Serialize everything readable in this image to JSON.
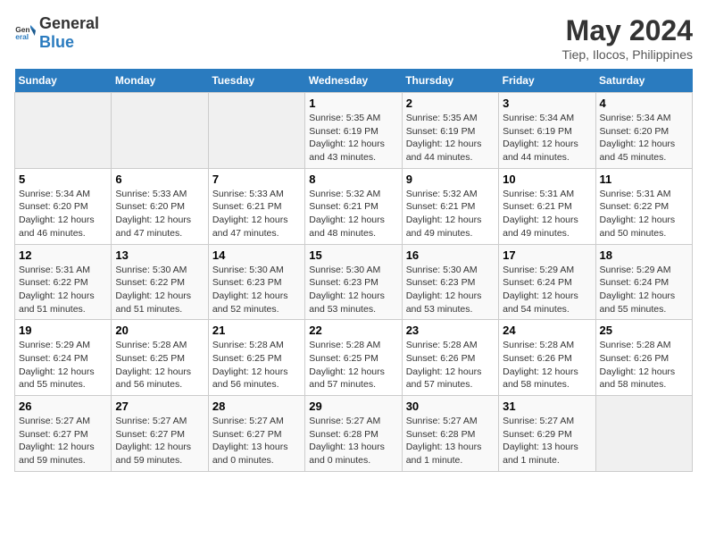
{
  "header": {
    "logo_general": "General",
    "logo_blue": "Blue",
    "title": "May 2024",
    "subtitle": "Tiep, Ilocos, Philippines"
  },
  "weekdays": [
    "Sunday",
    "Monday",
    "Tuesday",
    "Wednesday",
    "Thursday",
    "Friday",
    "Saturday"
  ],
  "weeks": [
    [
      {
        "day": "",
        "info": ""
      },
      {
        "day": "",
        "info": ""
      },
      {
        "day": "",
        "info": ""
      },
      {
        "day": "1",
        "info": "Sunrise: 5:35 AM\nSunset: 6:19 PM\nDaylight: 12 hours\nand 43 minutes."
      },
      {
        "day": "2",
        "info": "Sunrise: 5:35 AM\nSunset: 6:19 PM\nDaylight: 12 hours\nand 44 minutes."
      },
      {
        "day": "3",
        "info": "Sunrise: 5:34 AM\nSunset: 6:19 PM\nDaylight: 12 hours\nand 44 minutes."
      },
      {
        "day": "4",
        "info": "Sunrise: 5:34 AM\nSunset: 6:20 PM\nDaylight: 12 hours\nand 45 minutes."
      }
    ],
    [
      {
        "day": "5",
        "info": "Sunrise: 5:34 AM\nSunset: 6:20 PM\nDaylight: 12 hours\nand 46 minutes."
      },
      {
        "day": "6",
        "info": "Sunrise: 5:33 AM\nSunset: 6:20 PM\nDaylight: 12 hours\nand 47 minutes."
      },
      {
        "day": "7",
        "info": "Sunrise: 5:33 AM\nSunset: 6:21 PM\nDaylight: 12 hours\nand 47 minutes."
      },
      {
        "day": "8",
        "info": "Sunrise: 5:32 AM\nSunset: 6:21 PM\nDaylight: 12 hours\nand 48 minutes."
      },
      {
        "day": "9",
        "info": "Sunrise: 5:32 AM\nSunset: 6:21 PM\nDaylight: 12 hours\nand 49 minutes."
      },
      {
        "day": "10",
        "info": "Sunrise: 5:31 AM\nSunset: 6:21 PM\nDaylight: 12 hours\nand 49 minutes."
      },
      {
        "day": "11",
        "info": "Sunrise: 5:31 AM\nSunset: 6:22 PM\nDaylight: 12 hours\nand 50 minutes."
      }
    ],
    [
      {
        "day": "12",
        "info": "Sunrise: 5:31 AM\nSunset: 6:22 PM\nDaylight: 12 hours\nand 51 minutes."
      },
      {
        "day": "13",
        "info": "Sunrise: 5:30 AM\nSunset: 6:22 PM\nDaylight: 12 hours\nand 51 minutes."
      },
      {
        "day": "14",
        "info": "Sunrise: 5:30 AM\nSunset: 6:23 PM\nDaylight: 12 hours\nand 52 minutes."
      },
      {
        "day": "15",
        "info": "Sunrise: 5:30 AM\nSunset: 6:23 PM\nDaylight: 12 hours\nand 53 minutes."
      },
      {
        "day": "16",
        "info": "Sunrise: 5:30 AM\nSunset: 6:23 PM\nDaylight: 12 hours\nand 53 minutes."
      },
      {
        "day": "17",
        "info": "Sunrise: 5:29 AM\nSunset: 6:24 PM\nDaylight: 12 hours\nand 54 minutes."
      },
      {
        "day": "18",
        "info": "Sunrise: 5:29 AM\nSunset: 6:24 PM\nDaylight: 12 hours\nand 55 minutes."
      }
    ],
    [
      {
        "day": "19",
        "info": "Sunrise: 5:29 AM\nSunset: 6:24 PM\nDaylight: 12 hours\nand 55 minutes."
      },
      {
        "day": "20",
        "info": "Sunrise: 5:28 AM\nSunset: 6:25 PM\nDaylight: 12 hours\nand 56 minutes."
      },
      {
        "day": "21",
        "info": "Sunrise: 5:28 AM\nSunset: 6:25 PM\nDaylight: 12 hours\nand 56 minutes."
      },
      {
        "day": "22",
        "info": "Sunrise: 5:28 AM\nSunset: 6:25 PM\nDaylight: 12 hours\nand 57 minutes."
      },
      {
        "day": "23",
        "info": "Sunrise: 5:28 AM\nSunset: 6:26 PM\nDaylight: 12 hours\nand 57 minutes."
      },
      {
        "day": "24",
        "info": "Sunrise: 5:28 AM\nSunset: 6:26 PM\nDaylight: 12 hours\nand 58 minutes."
      },
      {
        "day": "25",
        "info": "Sunrise: 5:28 AM\nSunset: 6:26 PM\nDaylight: 12 hours\nand 58 minutes."
      }
    ],
    [
      {
        "day": "26",
        "info": "Sunrise: 5:27 AM\nSunset: 6:27 PM\nDaylight: 12 hours\nand 59 minutes."
      },
      {
        "day": "27",
        "info": "Sunrise: 5:27 AM\nSunset: 6:27 PM\nDaylight: 12 hours\nand 59 minutes."
      },
      {
        "day": "28",
        "info": "Sunrise: 5:27 AM\nSunset: 6:27 PM\nDaylight: 13 hours\nand 0 minutes."
      },
      {
        "day": "29",
        "info": "Sunrise: 5:27 AM\nSunset: 6:28 PM\nDaylight: 13 hours\nand 0 minutes."
      },
      {
        "day": "30",
        "info": "Sunrise: 5:27 AM\nSunset: 6:28 PM\nDaylight: 13 hours\nand 1 minute."
      },
      {
        "day": "31",
        "info": "Sunrise: 5:27 AM\nSunset: 6:29 PM\nDaylight: 13 hours\nand 1 minute."
      },
      {
        "day": "",
        "info": ""
      }
    ]
  ]
}
